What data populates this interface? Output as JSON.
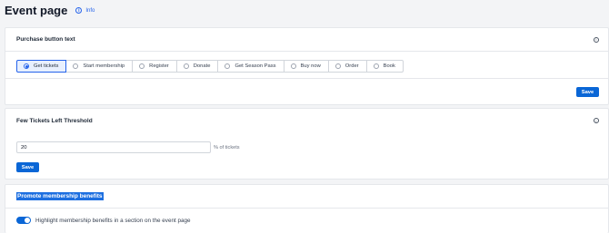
{
  "page": {
    "title": "Event page",
    "info_label": "Info"
  },
  "purchase": {
    "title": "Purchase button text",
    "options": [
      "Get tickets",
      "Start membership",
      "Register",
      "Donate",
      "Get Season Pass",
      "Buy now",
      "Order",
      "Book"
    ],
    "selected": "Get tickets",
    "save_label": "Save"
  },
  "threshold": {
    "title": "Few Tickets Left Threshold",
    "value": "20",
    "suffix": "% of tickets",
    "save_label": "Save"
  },
  "membership": {
    "title": "Promote membership benefits",
    "toggle_label": "Highlight membership benefits in a section on the event page",
    "toggle_on": true
  },
  "colors": {
    "accent": "#0a66d6",
    "selected_bg": "#e8f0fe"
  }
}
